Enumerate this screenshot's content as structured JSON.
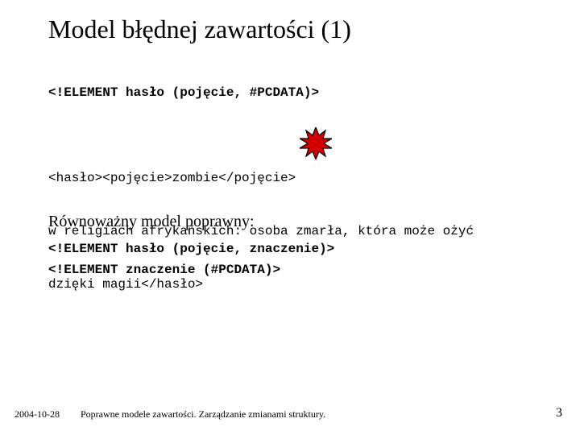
{
  "title": "Model błędnej zawartości (1)",
  "dtd_bad": "<!ELEMENT hasło (pojęcie, #PCDATA)>",
  "example_l1": "<hasło><pojęcie>zombie</pojęcie>",
  "example_l2": "w religiach afrykańskich: osoba zmarła, która może ożyć",
  "example_l3": "dzięki magii</hasło>",
  "equiv_label": "Równoważny model poprawny:",
  "dtd_fix1": "<!ELEMENT hasło (pojęcie, znaczenie)>",
  "dtd_fix2": "<!ELEMENT znaczenie (#PCDATA)>",
  "footer": {
    "date": "2004-10-28",
    "text": "Poprawne modele zawartości. Zarządzanie zmianami struktury.",
    "page": "3"
  }
}
